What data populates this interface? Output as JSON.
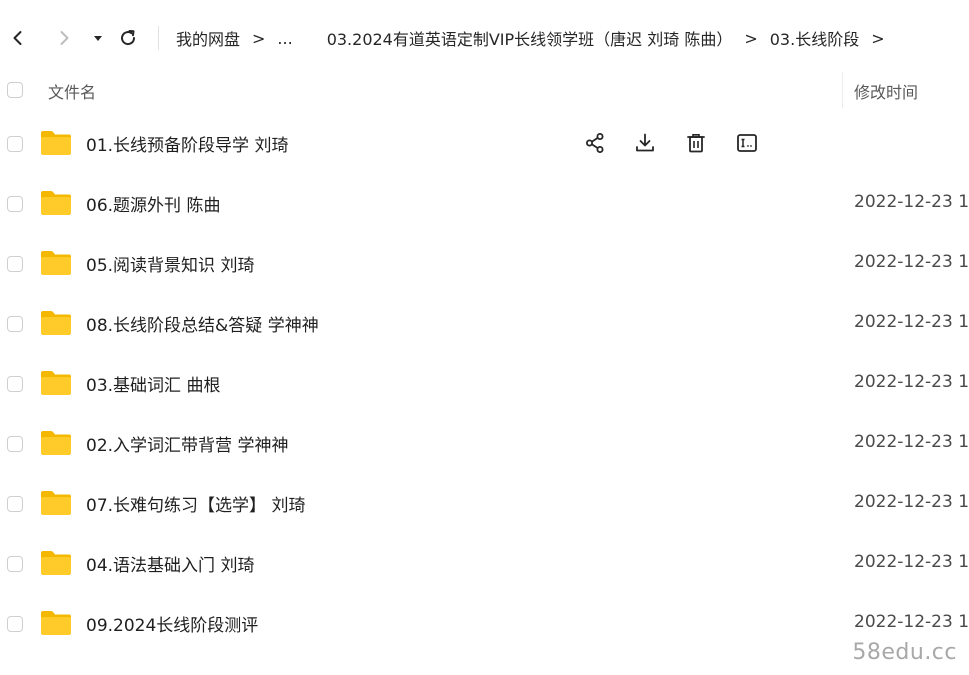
{
  "toolbar": {
    "back_icon": "chevron-left-icon",
    "forward_icon": "chevron-right-icon",
    "dropdown_icon": "caret-down-icon",
    "refresh_icon": "refresh-icon"
  },
  "breadcrumb": {
    "items": [
      "我的网盘",
      "...",
      "03.2024有道英语定制VIP长线领学班（唐迟 刘琦 陈曲）",
      "03.长线阶段"
    ],
    "separator": ">"
  },
  "table": {
    "columns": {
      "name": "文件名",
      "modified": "修改时间"
    },
    "rows": [
      {
        "name": "01.长线预备阶段导学  刘琦",
        "date": ""
      },
      {
        "name": "06.题源外刊  陈曲",
        "date": "2022-12-23 1"
      },
      {
        "name": "05.阅读背景知识  刘琦",
        "date": "2022-12-23 1"
      },
      {
        "name": "08.长线阶段总结&答疑  学神神",
        "date": "2022-12-23 1"
      },
      {
        "name": "03.基础词汇  曲根",
        "date": "2022-12-23 1"
      },
      {
        "name": "02.入学词汇带背营  学神神",
        "date": "2022-12-23 1"
      },
      {
        "name": "07.长难句练习【选学】 刘琦",
        "date": "2022-12-23 1"
      },
      {
        "name": "04.语法基础入门  刘琦",
        "date": "2022-12-23 1"
      },
      {
        "name": "09.2024长线阶段测评",
        "date": "2022-12-23 1"
      }
    ],
    "hover_actions": [
      "share-icon",
      "download-icon",
      "delete-icon",
      "rename-icon"
    ]
  },
  "colors": {
    "folder": "#FFCB2B",
    "folder_tab": "#F5B800",
    "icon_stroke": "#262626"
  },
  "watermark": "58edu.cc"
}
